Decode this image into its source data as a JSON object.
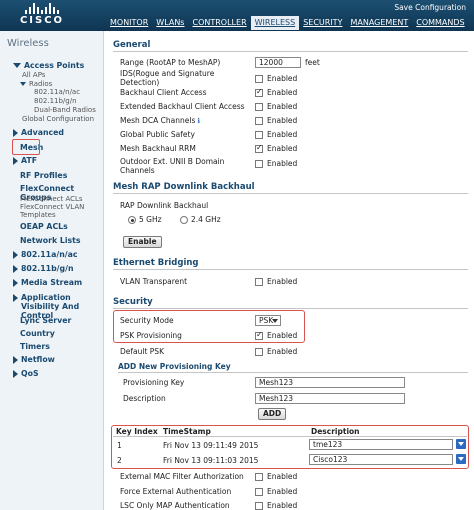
{
  "header": {
    "brand": "CISCO",
    "save_config": "Save Configuration",
    "nav": [
      "MONITOR",
      "WLANs",
      "CONTROLLER",
      "WIRELESS",
      "SECURITY",
      "MANAGEMENT",
      "COMMANDS"
    ],
    "active_nav": "WIRELESS"
  },
  "sidebar": {
    "title": "Wireless",
    "access_points": "Access Points",
    "all_aps": "All APs",
    "radios": "Radios",
    "radio_ac": "802.11a/n/ac",
    "radio_bgn": "802.11b/g/n",
    "dual_band": "Dual-Band Radios",
    "global_config": "Global Configuration",
    "advanced": "Advanced",
    "mesh": "Mesh",
    "atf": "ATF",
    "rf_profiles": "RF Profiles",
    "flexconnect_groups": "FlexConnect Groups",
    "flexconnect_acls": "FlexConnect ACLs",
    "flexconnect_vlan": "FlexConnect VLAN Templates",
    "oeap_acls": "OEAP ACLs",
    "network_lists": "Network Lists",
    "band_anac": "802.11a/n/ac",
    "band_bgn": "802.11b/g/n",
    "media_stream": "Media Stream",
    "app_visibility": "Application Visibility And Control",
    "lync_server": "Lync Server",
    "country": "Country",
    "timers": "Timers",
    "netflow": "Netflow",
    "qos": "QoS"
  },
  "general": {
    "heading": "General",
    "range_label": "Range (RootAP to MeshAP)",
    "range_value": "12000",
    "range_unit": "feet",
    "ids_label": "IDS(Rogue and Signature Detection)",
    "backhaul_client_label": "Backhaul Client Access",
    "ext_backhaul_label": "Extended Backhaul Client Access",
    "mesh_dca_label": "Mesh DCA Channels",
    "global_public_label": "Global Public Safety",
    "mesh_rrm_label": "Mesh Backhaul RRM",
    "outdoor_unii_label": "Outdoor Ext. UNII B Domain Channels",
    "enabled": "Enabled"
  },
  "rap_downlink": {
    "heading": "Mesh RAP Downlink Backhaul",
    "label": "RAP Downlink Backhaul",
    "opt_5": "5 GHz",
    "opt_24": "2.4 GHz",
    "enable_btn": "Enable"
  },
  "ethernet": {
    "heading": "Ethernet Bridging",
    "vlan_label": "VLAN Transparent",
    "enabled": "Enabled"
  },
  "security": {
    "heading": "Security",
    "mode_label": "Security Mode",
    "mode_value": "PSK",
    "psk_prov_label": "PSK Provisioning",
    "default_psk_label": "Default PSK",
    "enabled": "Enabled",
    "add_heading": "ADD New Provisioning Key",
    "prov_key_label": "Provisioning Key",
    "prov_key_value": "Mesh123",
    "desc_label": "Description",
    "desc_value": "Mesh123",
    "add_btn": "ADD"
  },
  "key_table": {
    "headers": [
      "Key Index",
      "TimeStamp",
      "Description"
    ],
    "rows": [
      {
        "index": "1",
        "timestamp": "Fri Nov 13 09:11:49 2015",
        "description": "tme123"
      },
      {
        "index": "2",
        "timestamp": "Fri Nov 13 09:11:03 2015",
        "description": "Cisco123"
      }
    ]
  },
  "auth": {
    "ext_mac_label": "External MAC Filter Authorization",
    "force_ext_label": "Force External Authentication",
    "lsc_only_label": "LSC Only MAP Authentication",
    "enabled": "Enabled"
  },
  "colors": {
    "header_bg": "#1c4f72",
    "link": "#1a4a70",
    "highlight": "#d9534f"
  }
}
